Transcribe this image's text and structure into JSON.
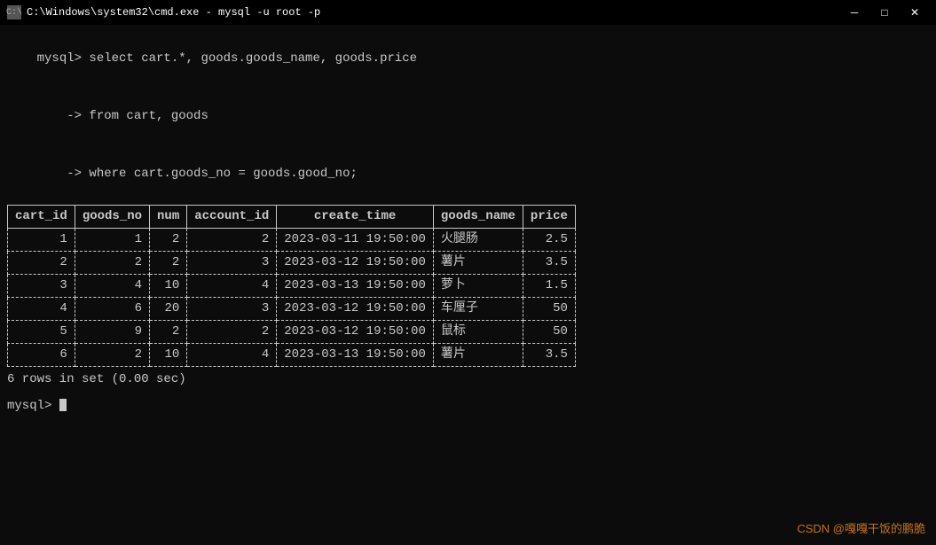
{
  "titlebar": {
    "title": "C:\\Windows\\system32\\cmd.exe - mysql  -u root -p",
    "icon": "C",
    "minimize_label": "─",
    "restore_label": "□",
    "close_label": "✕"
  },
  "terminal": {
    "prompt1": "mysql> select cart.*, goods.goods_name, goods.price",
    "prompt2": "    -> from cart, goods",
    "prompt3": "    -> where cart.goods_no = goods.good_no;",
    "columns": [
      "cart_id",
      "goods_no",
      "num",
      "account_id",
      "create_time",
      "goods_name",
      "price"
    ],
    "rows": [
      [
        "1",
        "1",
        "2",
        "2",
        "2023-03-11 19:50:00",
        "火腿肠",
        "2.5"
      ],
      [
        "2",
        "2",
        "2",
        "3",
        "2023-03-12 19:50:00",
        "薯片",
        "3.5"
      ],
      [
        "3",
        "4",
        "10",
        "4",
        "2023-03-13 19:50:00",
        "萝卜",
        "1.5"
      ],
      [
        "4",
        "6",
        "20",
        "3",
        "2023-03-12 19:50:00",
        "车厘子",
        "50"
      ],
      [
        "5",
        "9",
        "2",
        "2",
        "2023-03-12 19:50:00",
        "鼠标",
        "50"
      ],
      [
        "6",
        "2",
        "10",
        "4",
        "2023-03-13 19:50:00",
        "薯片",
        "3.5"
      ]
    ],
    "result_text": "6 rows in set (0.00 sec)",
    "next_prompt": "mysql> ",
    "watermark": "CSDN @嘎嘎干饭的鹏脆"
  }
}
